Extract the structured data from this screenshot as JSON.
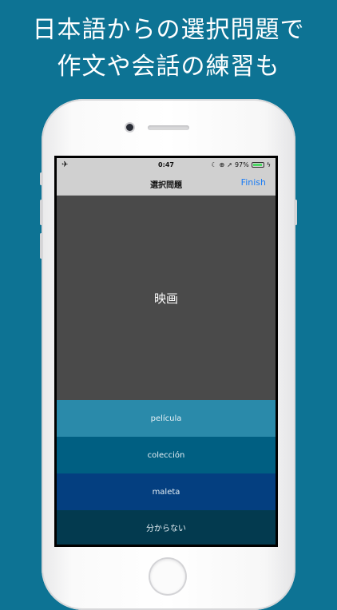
{
  "promo": {
    "line1": "日本語からの選択問題で",
    "line2": "作文や会話の練習も"
  },
  "status_bar": {
    "time": "0:47",
    "battery": "97%",
    "battery_level": 0.97,
    "icons": [
      "airplane-icon",
      "moon-icon",
      "lock-rotation-icon",
      "location-arrow-icon",
      "battery-icon",
      "charging-icon"
    ]
  },
  "nav": {
    "title": "選択問題",
    "finish_label": "Finish"
  },
  "question": {
    "word": "映画"
  },
  "choices": [
    {
      "label": "película",
      "color": "#2a8aaa"
    },
    {
      "label": "colección",
      "color": "#005f82"
    },
    {
      "label": "maleta",
      "color": "#043f80"
    },
    {
      "label": "分からない",
      "color": "#033a4f"
    }
  ],
  "colors": {
    "background": "#0d7394",
    "link": "#1a7cf5"
  }
}
